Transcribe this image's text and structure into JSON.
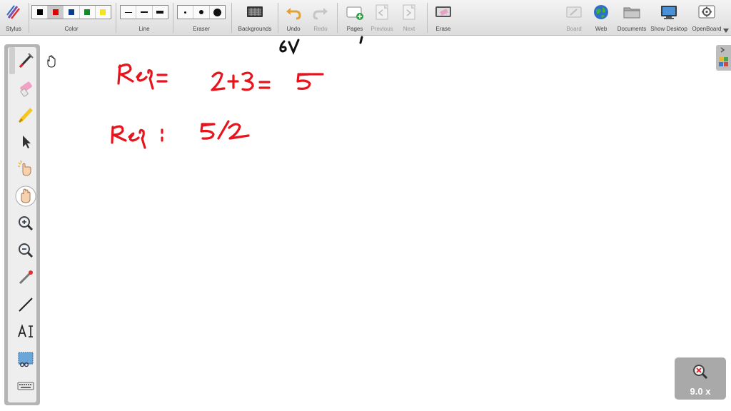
{
  "toolbar": {
    "stylus_label": "Stylus",
    "color_label": "Color",
    "line_label": "Line",
    "eraser_label": "Eraser",
    "backgrounds_label": "Backgrounds",
    "undo_label": "Undo",
    "redo_label": "Redo",
    "pages_label": "Pages",
    "previous_label": "Previous",
    "next_label": "Next",
    "erase_label": "Erase",
    "board_label": "Board",
    "web_label": "Web",
    "documents_label": "Documents",
    "show_desktop_label": "Show Desktop",
    "openboard_label": "OpenBoard",
    "colors": [
      "#000000",
      "#e00000",
      "#0a3d8f",
      "#118a2a",
      "#f5e41a"
    ],
    "selected_color_index": 1
  },
  "board": {
    "ink_color": "#e8141d"
  },
  "zoom": {
    "level": "9.0 x"
  }
}
